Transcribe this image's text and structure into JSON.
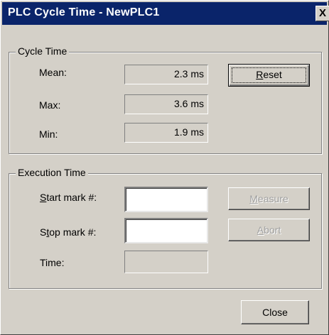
{
  "window": {
    "title": "PLC Cycle Time - NewPLC1",
    "close_glyph": "X"
  },
  "cycle_time": {
    "group_label": "Cycle Time",
    "mean_label": "Mean:",
    "mean_value": "2.3 ms",
    "max_label": "Max:",
    "max_value": "3.6 ms",
    "min_label": "Min:",
    "min_value": "1.9 ms",
    "reset_button": {
      "first": "R",
      "rest": "eset"
    }
  },
  "execution_time": {
    "group_label": "Execution Time",
    "start_label": {
      "first": "S",
      "rest": "tart mark #:"
    },
    "start_value": "",
    "stop_label": {
      "first": "S",
      "mid": "t",
      "rest": "op mark #:"
    },
    "stop_value": "",
    "time_label": "Time:",
    "time_value": "",
    "measure_button": {
      "first": "M",
      "rest": "easure"
    },
    "abort_button": {
      "first": "A",
      "rest": "bort"
    }
  },
  "close_button": "Close"
}
